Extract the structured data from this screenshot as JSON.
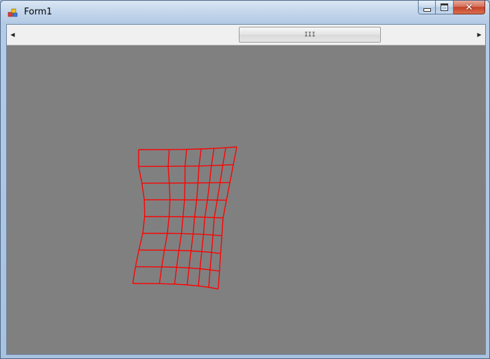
{
  "window": {
    "title": "Form1",
    "caption_buttons": {
      "minimize": "minimize",
      "maximize": "maximize",
      "close": "✕"
    }
  },
  "scrollbar": {
    "orientation": "horizontal",
    "thumb_grip": "III",
    "left_arrow": "◀",
    "right_arrow": "▶",
    "position_fraction": 0.45
  },
  "canvas": {
    "background": "#808080",
    "wireframe_color": "#ff0000",
    "wireframe_icon": "red-wireframe-mesh-icon"
  },
  "colors": {
    "client_background": "#808080",
    "scrollbar_background": "#f0f0f0",
    "mesh": "#ff0000"
  }
}
